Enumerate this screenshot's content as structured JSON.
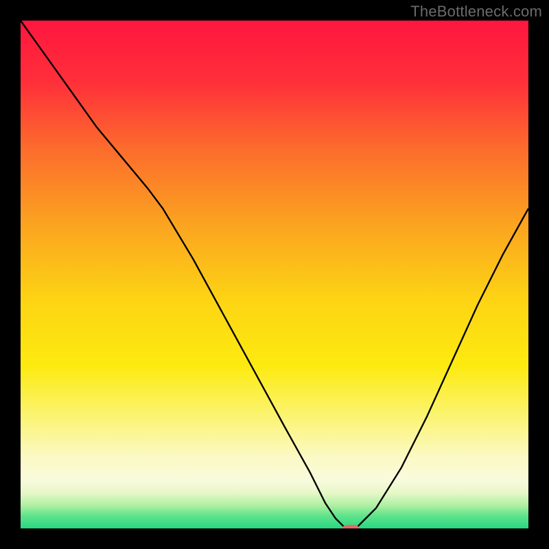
{
  "watermark": "TheBottleneck.com",
  "chart_data": {
    "type": "line",
    "title": "",
    "xlabel": "",
    "ylabel": "",
    "xlim": [
      0,
      100
    ],
    "ylim": [
      0,
      100
    ],
    "gradient": [
      {
        "offset": 0.0,
        "color": "#ff163f"
      },
      {
        "offset": 0.12,
        "color": "#ff2f3a"
      },
      {
        "offset": 0.25,
        "color": "#fc6b2d"
      },
      {
        "offset": 0.4,
        "color": "#fba320"
      },
      {
        "offset": 0.55,
        "color": "#fdd414"
      },
      {
        "offset": 0.68,
        "color": "#fdea10"
      },
      {
        "offset": 0.78,
        "color": "#fbf473"
      },
      {
        "offset": 0.86,
        "color": "#fbf9c5"
      },
      {
        "offset": 0.905,
        "color": "#f9fadd"
      },
      {
        "offset": 0.93,
        "color": "#e6f8c8"
      },
      {
        "offset": 0.955,
        "color": "#aef0a3"
      },
      {
        "offset": 0.975,
        "color": "#5fe38b"
      },
      {
        "offset": 1.0,
        "color": "#27d882"
      }
    ],
    "series": [
      {
        "name": "bottleneck-curve",
        "x": [
          0,
          5,
          10,
          15,
          20,
          25,
          28,
          34,
          40,
          46,
          52,
          57,
          60,
          62,
          64,
          66,
          70,
          75,
          80,
          85,
          90,
          95,
          100
        ],
        "y": [
          100,
          93,
          86,
          79,
          73,
          67,
          63,
          53,
          42,
          31,
          20,
          11,
          5,
          2,
          0,
          0,
          4,
          12,
          22,
          33,
          44,
          54,
          63
        ]
      }
    ],
    "marker": {
      "x": 65,
      "y": 0,
      "width_pct": 3.3,
      "height_pct": 1.4,
      "fill": "#e46a63"
    }
  }
}
